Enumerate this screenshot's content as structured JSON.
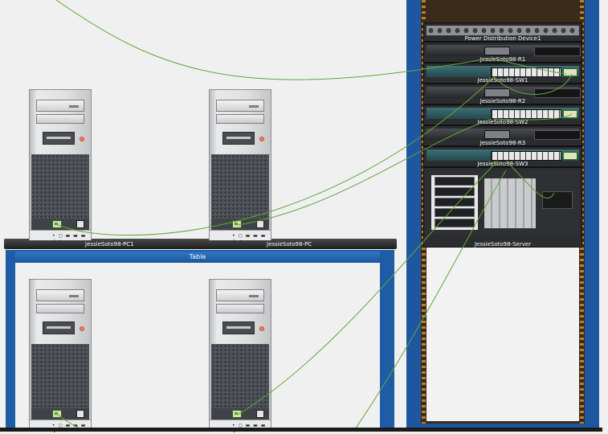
{
  "colors": {
    "wire": "#5fa83a",
    "table_frame": "#1e5ca6",
    "rack_frame": "#1e56a0"
  },
  "table": {
    "label": "Table"
  },
  "pcs": [
    {
      "label": "JessieSoto98-PC1",
      "ports_text": "• ○ ▬ ▬ ▬ ↓ •"
    },
    {
      "label": "JessieSoto98-PC",
      "ports_text": "• ○ ▬ ▬ ▬ ↓ •"
    },
    {
      "label": "",
      "ports_text": "• ○ ▬ ▬ ▬ ↓ •"
    },
    {
      "label": "",
      "ports_text": "• ○ ▬ ▬ ▬ ↓ •"
    }
  ],
  "rack": {
    "devices": [
      {
        "label": "Power Distribution Device1",
        "kind": "pdu"
      },
      {
        "label": "JessieSoto98-R1",
        "kind": "router"
      },
      {
        "label": "JessieSoto98-SW1",
        "kind": "switch"
      },
      {
        "label": "JessieSoto98-R2",
        "kind": "router"
      },
      {
        "label": "JessieSoto98-SW2",
        "kind": "switch"
      },
      {
        "label": "JessieSoto98-R3",
        "kind": "router"
      },
      {
        "label": "JessieSoto98-SW3",
        "kind": "switch"
      },
      {
        "label": "JessieSoto98-Server",
        "kind": "server"
      }
    ]
  }
}
